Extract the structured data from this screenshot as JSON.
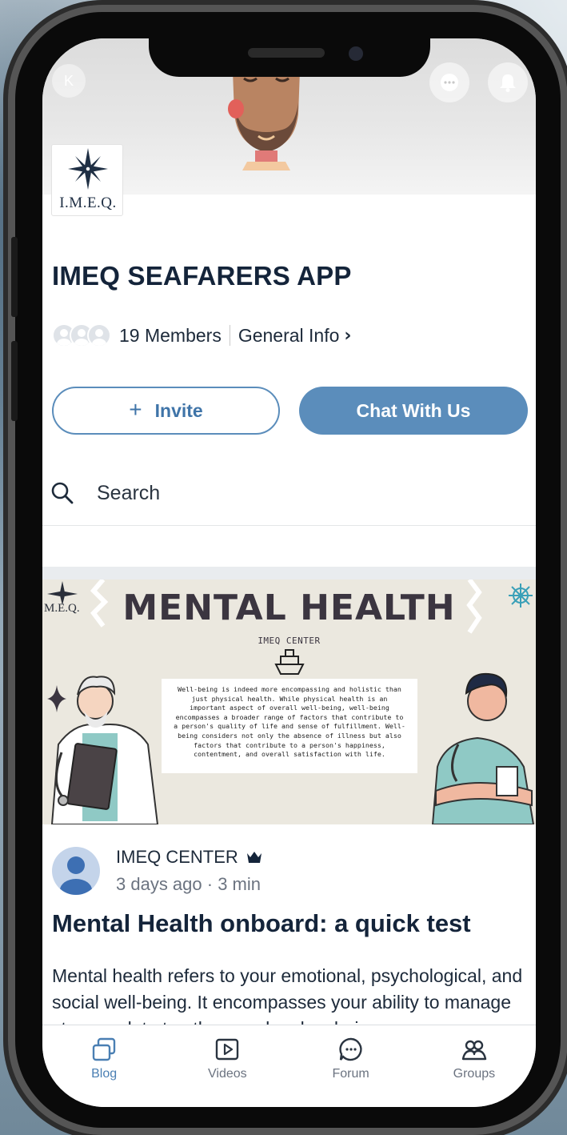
{
  "header": {
    "user_initial": "K",
    "logo_text": "I.M.E.Q."
  },
  "group": {
    "title": "IMEQ SEAFARERS APP",
    "members_label": "19 Members",
    "info_label": "General Info"
  },
  "actions": {
    "invite_label": "Invite",
    "chat_label": "Chat With Us"
  },
  "search": {
    "label": "Search"
  },
  "banner": {
    "title": "MENTAL HEALTH",
    "subtitle": "IMEQ CENTER",
    "logo_text": "M.E.Q.",
    "body": "Well-being is indeed more encompassing and holistic than just physical health. While physical health is an important aspect of overall well-being, well-being encompasses a broader range of factors that contribute to a person's quality of life and sense of fulfillment. Well-being considers not only the absence of illness but also factors that contribute to a person's happiness, contentment, and overall satisfaction with life."
  },
  "post": {
    "author": "IMEQ CENTER",
    "meta": "3 days ago · 3 min",
    "title": "Mental Health onboard: a quick test",
    "excerpt": "Mental health refers to your emotional, psychological, and social well-being. It encompasses your ability to manage stress, relate to others and make choices."
  },
  "nav": {
    "items": [
      {
        "label": "Blog",
        "icon": "blog-icon",
        "active": true
      },
      {
        "label": "Videos",
        "icon": "video-icon",
        "active": false
      },
      {
        "label": "Forum",
        "icon": "forum-icon",
        "active": false
      },
      {
        "label": "Groups",
        "icon": "groups-icon",
        "active": false
      }
    ]
  },
  "colors": {
    "accent": "#5b8dbb",
    "title": "#14243a",
    "nav_active": "#4a7fb3"
  }
}
